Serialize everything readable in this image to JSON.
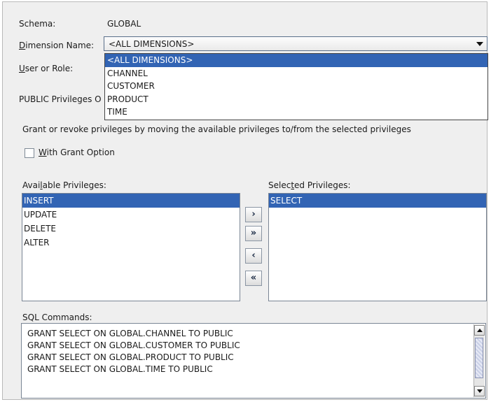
{
  "schema": {
    "label": "Schema:",
    "value": "GLOBAL"
  },
  "dimension": {
    "label_prefix": "D",
    "label_rest": "imension Name:",
    "selected": "<ALL DIMENSIONS>",
    "options": [
      "<ALL DIMENSIONS>",
      "CHANNEL",
      "CUSTOMER",
      "PRODUCT",
      "TIME"
    ]
  },
  "user_role": {
    "label_prefix": "U",
    "label_rest": "ser or Role:"
  },
  "public_privileges": {
    "label": "PUBLIC Privileges O"
  },
  "instructions": "Grant or revoke privileges by moving the available privileges to/from the selected privileges",
  "grant_option": {
    "prefix": "W",
    "rest": "ith Grant Option",
    "checked": false
  },
  "available": {
    "label_a": "Avai",
    "label_u": "l",
    "label_b": "able Privileges:",
    "items": [
      "INSERT",
      "UPDATE",
      "DELETE",
      "ALTER"
    ],
    "selected_index": 0
  },
  "selected": {
    "label_a": "Selec",
    "label_u": "t",
    "label_b": "ed Privileges:",
    "items": [
      "SELECT"
    ]
  },
  "transfer_buttons": {
    "add": "›",
    "add_all": "»",
    "remove": "‹",
    "remove_all": "«"
  },
  "sql": {
    "label": "SQL Commands:",
    "lines": [
      "GRANT SELECT ON GLOBAL.CHANNEL TO PUBLIC",
      "GRANT SELECT ON GLOBAL.CUSTOMER TO PUBLIC",
      "GRANT SELECT ON GLOBAL.PRODUCT TO PUBLIC",
      "GRANT SELECT ON GLOBAL.TIME TO PUBLIC"
    ]
  },
  "colors": {
    "selection": "#3264b4",
    "dialog_bg": "#efefef"
  }
}
